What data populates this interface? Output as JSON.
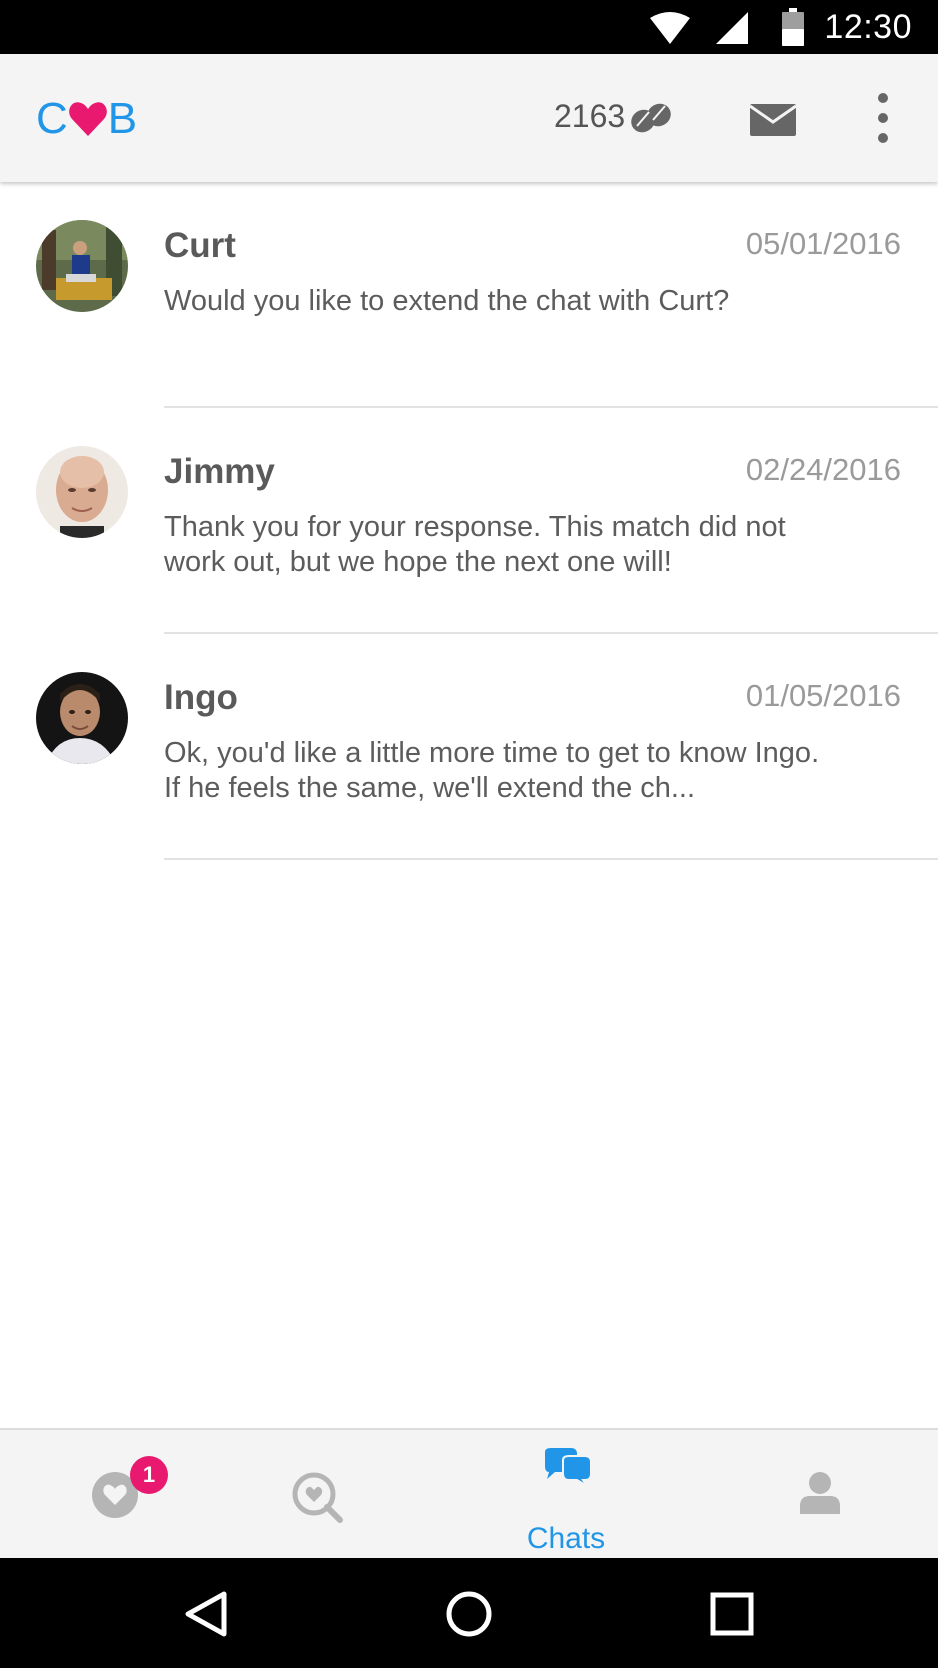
{
  "status_bar": {
    "time": "12:30",
    "icons": [
      "wifi-icon",
      "cell-signal-icon",
      "battery-icon"
    ]
  },
  "app_bar": {
    "logo": {
      "left": "C",
      "right": "B",
      "heart_color": "#e8196e",
      "letter_color": "#2196e8"
    },
    "coin_count": "2163",
    "coin_icon": "coins-icon",
    "mail_icon": "mail-icon",
    "menu_icon": "overflow-menu-icon"
  },
  "chats": [
    {
      "name": "Curt",
      "date": "05/01/2016",
      "message": "Would you like to extend the chat with Curt?"
    },
    {
      "name": "Jimmy",
      "date": "02/24/2016",
      "message": "Thank you for your response. This match did not work out, but we hope the next one will!"
    },
    {
      "name": "Ingo",
      "date": "01/05/2016",
      "message": "Ok, you'd like a little more time to get to know Ingo. If he feels the same, we'll extend the ch..."
    }
  ],
  "bottom_nav": {
    "items": [
      {
        "icon": "heart-circle-icon",
        "badge": "1"
      },
      {
        "icon": "discover-search-icon"
      },
      {
        "icon": "chat-bubbles-icon",
        "label": "Chats",
        "active": true
      },
      {
        "icon": "profile-icon"
      }
    ],
    "active_color": "#2196e8",
    "badge_color": "#e8196e"
  },
  "system_nav": {
    "icons": [
      "back-icon",
      "home-icon",
      "recents-icon"
    ]
  }
}
